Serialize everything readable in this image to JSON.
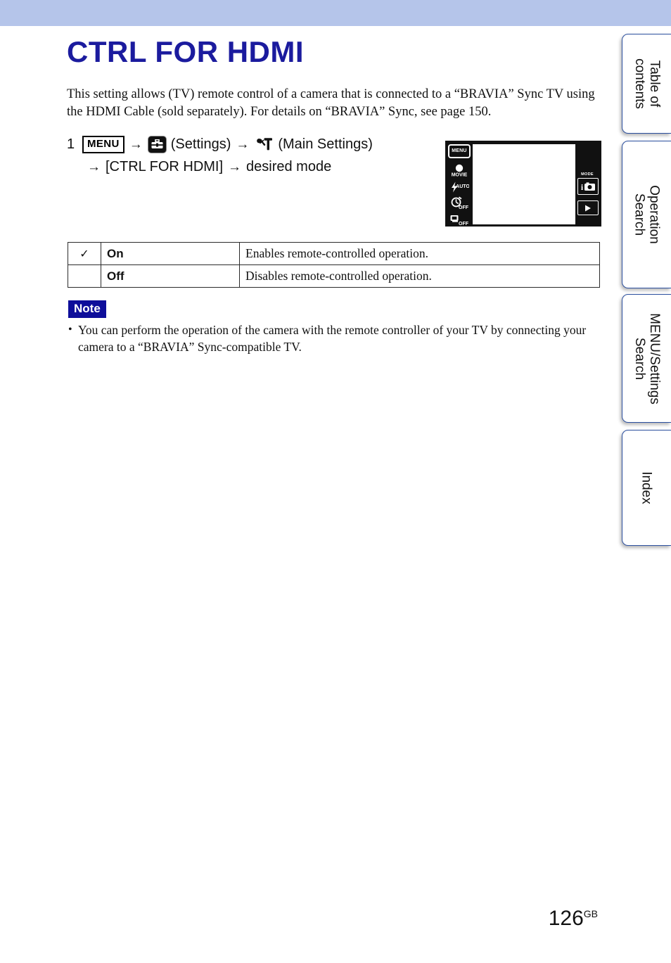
{
  "document": {
    "title": "CTRL FOR HDMI",
    "intro": "This setting allows (TV) remote control of a camera that is connected to a “BRAVIA” Sync TV using the HDMI Cable (sold separately). For details on “BRAVIA” Sync, see page 150.",
    "title_color": "#1b1b9e",
    "band_color": "#b5c5ea"
  },
  "step": {
    "number": "1",
    "menu_chip": "MENU",
    "arrow": "→",
    "settings_label": "(Settings)",
    "main_settings_label": "(Main Settings)",
    "second_line_item": "[CTRL FOR HDMI]",
    "second_line_tail": "desired mode",
    "settings_icon": "toolbox-icon",
    "main_settings_icon": "wrench-hammer-icon"
  },
  "camera_screen": {
    "menu_button": "MENU",
    "left_icons": [
      {
        "name": "movie-mode-icon",
        "label": "MOVIE"
      },
      {
        "name": "flash-auto-icon",
        "label": "AUTO"
      },
      {
        "name": "self-timer-off-icon",
        "label": "OFF"
      },
      {
        "name": "burst-off-icon",
        "label": "OFF"
      }
    ],
    "mode_label": "MODE",
    "mode_icon": "intelligent-auto-camera-icon",
    "playback_icon": "playback-triangle-icon"
  },
  "options_table": {
    "rows": [
      {
        "checked": true,
        "check_glyph": "✓",
        "label": "On",
        "description": "Enables remote-controlled operation."
      },
      {
        "checked": false,
        "check_glyph": "",
        "label": "Off",
        "description": "Disables remote-controlled operation."
      }
    ]
  },
  "note": {
    "badge": "Note",
    "badge_color": "#0e0e9a",
    "bullet": "•",
    "items": [
      "You can perform the operation of the camera with the remote controller of your TV by connecting your camera to a “BRAVIA” Sync-compatible TV."
    ]
  },
  "footer": {
    "page_number": "126",
    "region_code": "GB"
  },
  "side_tabs": [
    {
      "label": "Table of\ncontents",
      "line1": "Table of",
      "line2": "contents"
    },
    {
      "label": "Operation\nSearch",
      "line1": "Operation",
      "line2": "Search"
    },
    {
      "label": "MENU/Settings\nSearch",
      "line1": "MENU/Settings",
      "line2": "Search"
    },
    {
      "label": "Index",
      "line1": "Index",
      "line2": ""
    }
  ]
}
